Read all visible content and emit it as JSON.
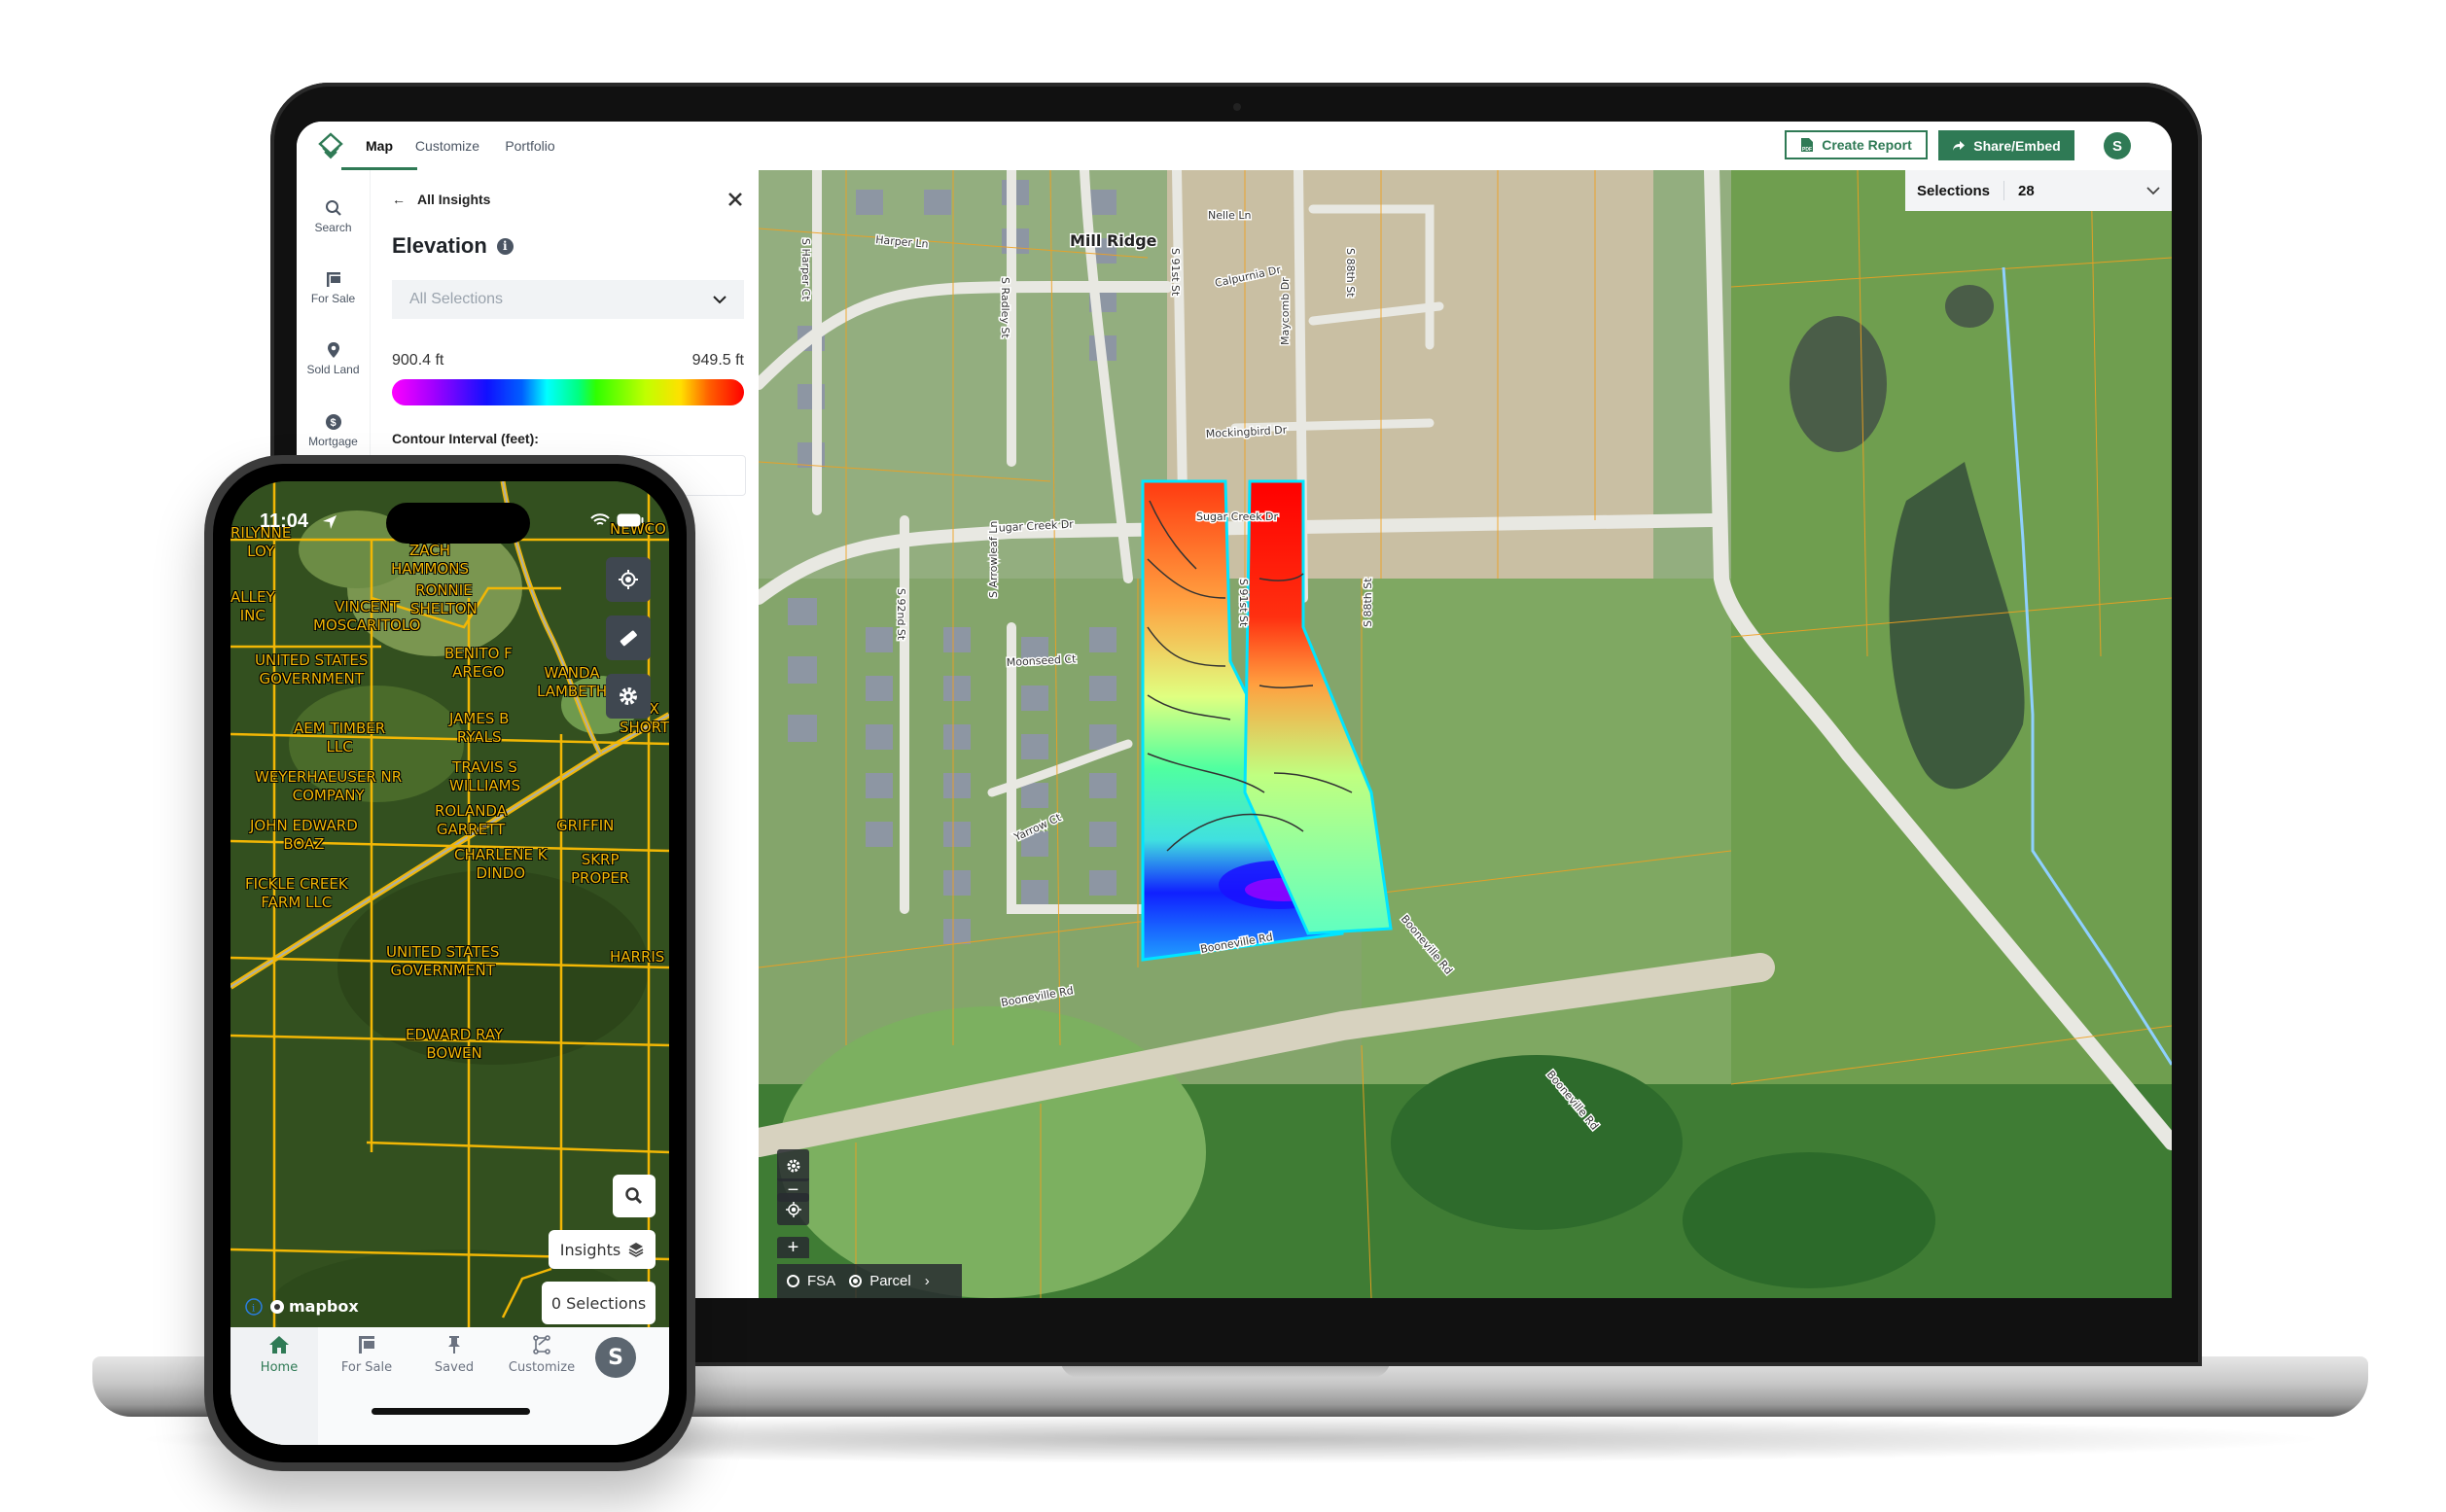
{
  "laptop": {
    "header": {
      "tabs": [
        {
          "label": "Map",
          "active": true
        },
        {
          "label": "Customize",
          "active": false
        },
        {
          "label": "Portfolio",
          "active": false
        }
      ],
      "create_report_label": "Create Report",
      "share_label": "Share/Embed",
      "avatar_initial": "S"
    },
    "leftnav": {
      "items": [
        {
          "label": "Search",
          "icon": "search-icon"
        },
        {
          "label": "For Sale",
          "icon": "for-sale-sign-icon"
        },
        {
          "label": "Sold Land",
          "icon": "map-pin-icon"
        },
        {
          "label": "Mortgage",
          "icon": "dollar-icon"
        }
      ]
    },
    "panel": {
      "back_label": "All Insights",
      "title": "Elevation",
      "select_placeholder": "All Selections",
      "min_label": "900.4 ft",
      "max_label": "949.5 ft",
      "contour_label": "Contour Interval (feet):"
    },
    "map": {
      "selections_label": "Selections",
      "selections_count": "28",
      "layers": [
        {
          "label": "FSA",
          "selected": false
        },
        {
          "label": "Parcel",
          "selected": true
        }
      ],
      "place_label": "Mill Ridge",
      "road_labels": [
        "Harper Ln",
        "S Harper Ct",
        "S Radley St",
        "S 91st St",
        "S 88th St",
        "Nelle Ln",
        "Calpurnia Dr",
        "Mockingbird Dr",
        "Maycomb Dr",
        "Sugar Creek Dr",
        "Sugar Creek Dr",
        "S 92nd St",
        "S Arrowleaf Ln",
        "Moonseed Ct",
        "Yarrow Ct",
        "Booneville Rd",
        "Booneville Rd",
        "Booneville Rd",
        "Booneville Rd",
        "S 91st St",
        "S 88th St"
      ],
      "colors": {
        "overlay_outline": "#00e5ff",
        "parcel_line": "#f0a020",
        "stream": "#8fd0ff"
      }
    }
  },
  "phone": {
    "status_time": "11:04",
    "owner_labels": [
      "RILYNNE LOY",
      "ZACH HAMMONS",
      "RONNIE SHELTON",
      "VINCENT MOSCARITOLO",
      "ALLEY INC",
      "NEWCO",
      "UNITED STATES GOVERNMENT",
      "BENITO F AREGO",
      "WANDA LAMBETH",
      "AEM TIMBER LLC",
      "JAMES B RYALS",
      "REX SHORT",
      "TRAVIS S WILLIAMS",
      "WEYERHAEUSER NR COMPANY",
      "ROLANDA GARRETT",
      "GRIFFIN",
      "JOHN EDWARD BOAZ",
      "CHARLENE K DINDO",
      "SKRP PROPER",
      "FICKLE CREEK FARM LLC",
      "UNITED STATES GOVERNMENT",
      "HARRIS",
      "EDWARD RAY BOWEN"
    ],
    "insights_label": "Insights",
    "selections_label": "0 Selections",
    "attribution": "mapbox",
    "tabbar": [
      {
        "label": "Home",
        "icon": "home-icon",
        "active": true
      },
      {
        "label": "For Sale",
        "icon": "for-sale-sign-icon",
        "active": false
      },
      {
        "label": "Saved",
        "icon": "pin-icon",
        "active": false
      },
      {
        "label": "Customize",
        "icon": "customize-icon",
        "active": false
      }
    ],
    "avatar_initial": "S"
  },
  "colors": {
    "brand_green": "#2f7a55",
    "parcel_yellow": "#f2b705"
  }
}
